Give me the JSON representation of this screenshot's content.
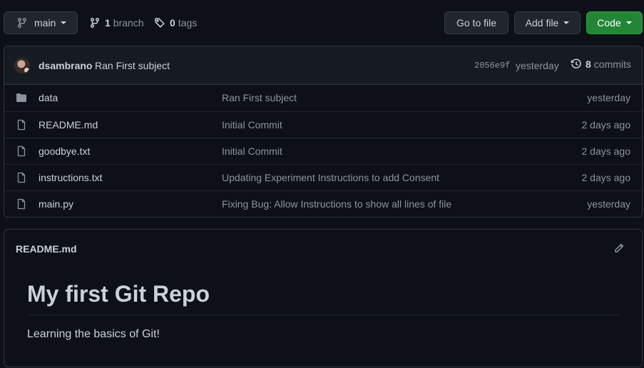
{
  "toolbar": {
    "branch_label": "main",
    "branch_count": "1",
    "branch_word": "branch",
    "tag_count": "0",
    "tag_word": "tags",
    "goto_label": "Go to file",
    "add_label": "Add file",
    "code_label": "Code"
  },
  "commit": {
    "author": "dsambrano",
    "message": "Ran First subject",
    "sha": "2056e9f",
    "time": "yesterday",
    "commits_count": "8",
    "commits_word": "commits"
  },
  "files": [
    {
      "name": "data",
      "icon": "folder-icon",
      "message": "Ran First subject",
      "time": "yesterday"
    },
    {
      "name": "README.md",
      "icon": "file-icon",
      "message": "Initial Commit",
      "time": "2 days ago"
    },
    {
      "name": "goodbye.txt",
      "icon": "file-icon",
      "message": "Initial Commit",
      "time": "2 days ago"
    },
    {
      "name": "instructions.txt",
      "icon": "file-icon",
      "message": "Updating Experiment Instructions to add Consent",
      "time": "2 days ago"
    },
    {
      "name": "main.py",
      "icon": "file-icon",
      "message": "Fixing Bug: Allow Instructions to show all lines of file",
      "time": "yesterday"
    }
  ],
  "readme": {
    "filename": "README.md",
    "heading": "My first Git Repo",
    "body": "Learning the basics of Git!"
  },
  "colors": {
    "background": "#0d1117",
    "code_button": "#238636",
    "muted_text": "#8b949e"
  }
}
